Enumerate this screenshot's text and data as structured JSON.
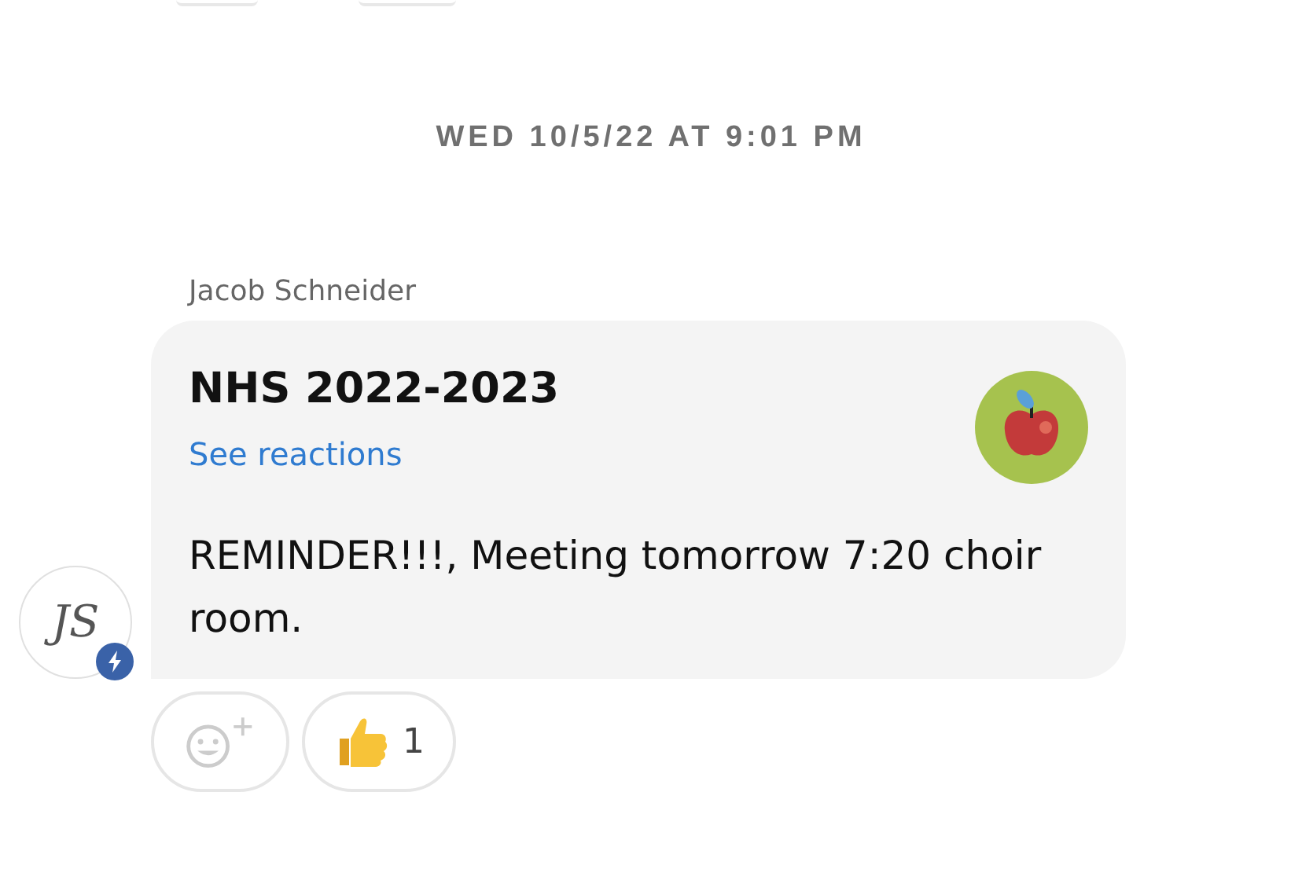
{
  "date_divider": "WED 10/5/22 AT 9:01 PM",
  "message": {
    "sender": "Jacob Schneider",
    "avatar_initials": "JS",
    "title": "NHS 2022-2023",
    "link": "See reactions",
    "body": "REMINDER!!!, Meeting tomorrow 7:20 choir room."
  },
  "reactions": [
    {
      "kind": "add"
    },
    {
      "kind": "thumbs_up",
      "count": "1"
    }
  ]
}
